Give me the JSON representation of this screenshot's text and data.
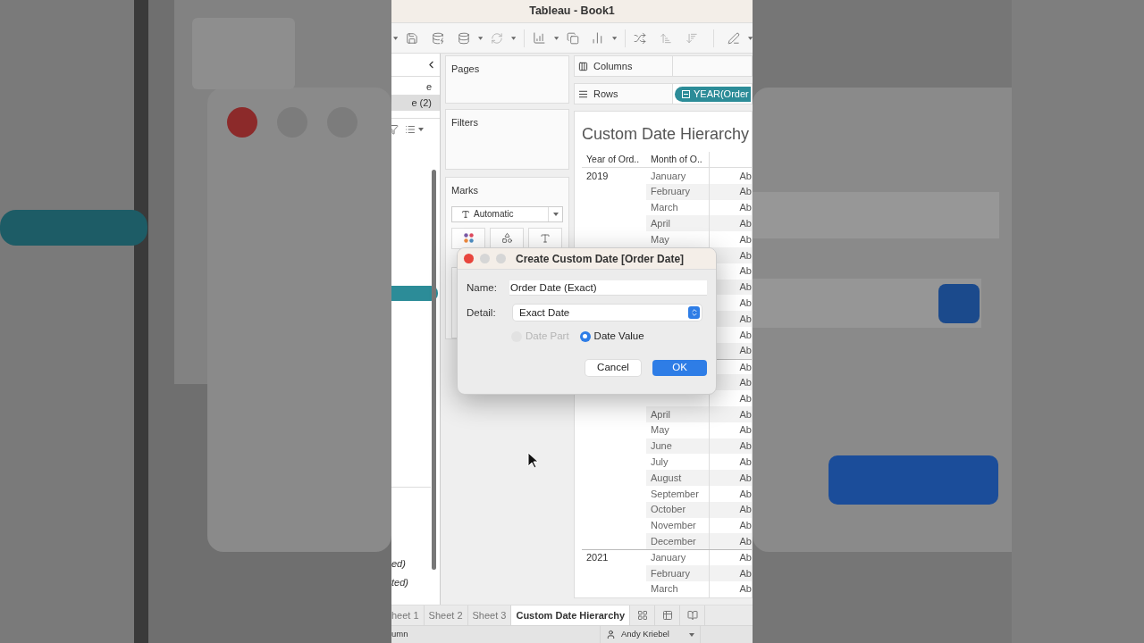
{
  "window": {
    "title": "Tableau - Book1"
  },
  "data_pane": {
    "items": [
      {
        "label": "e",
        "selected": false
      },
      {
        "label": "e (2)",
        "selected": true
      }
    ],
    "bottom_items": [
      "ed)",
      "ted)"
    ]
  },
  "cards": {
    "pages": "Pages",
    "filters": "Filters",
    "marks": "Marks",
    "mark_type": "Automatic"
  },
  "shelves": {
    "columns": "Columns",
    "rows": "Rows",
    "rows_pill": "YEAR(Order"
  },
  "view": {
    "title": "Custom Date Hierarchy",
    "columns": [
      "Year of Ord..",
      "Month of O.."
    ],
    "rows": [
      {
        "year": "2019",
        "month": "January",
        "column_3": "Ab"
      },
      {
        "month": "February",
        "column_3": "Ab"
      },
      {
        "month": "March",
        "column_3": "Ab"
      },
      {
        "month": "April",
        "column_3": "Ab"
      },
      {
        "month": "May",
        "column_3": "Ab"
      },
      {
        "column_3": "Ab"
      },
      {
        "column_3": "Ab"
      },
      {
        "column_3": "Ab"
      },
      {
        "column_3": "Ab"
      },
      {
        "column_3": "Ab"
      },
      {
        "column_3": "Ab"
      },
      {
        "column_3": "Ab"
      },
      {
        "group_start": true,
        "column_3": "Ab"
      },
      {
        "column_3": "Ab"
      },
      {
        "column_3": "Ab"
      },
      {
        "month": "April",
        "column_3": "Ab"
      },
      {
        "month": "May",
        "column_3": "Ab"
      },
      {
        "month": "June",
        "column_3": "Ab"
      },
      {
        "month": "July",
        "column_3": "Ab"
      },
      {
        "month": "August",
        "column_3": "Ab"
      },
      {
        "month": "September",
        "column_3": "Ab"
      },
      {
        "month": "October",
        "column_3": "Ab"
      },
      {
        "month": "November",
        "column_3": "Ab"
      },
      {
        "month": "December",
        "column_3": "Ab"
      },
      {
        "year": "2021",
        "month": "January",
        "column_3": "Ab"
      },
      {
        "month": "February",
        "column_3": "Ab"
      },
      {
        "month": "March",
        "column_3": "Ab"
      }
    ]
  },
  "dialog": {
    "title": "Create Custom Date [Order Date]",
    "name_label": "Name:",
    "name_value": "Order Date (Exact)",
    "detail_label": "Detail:",
    "detail_value": "Exact Date",
    "options": [
      {
        "label": "Date Part",
        "selected": false,
        "disabled": true
      },
      {
        "label": "Date Value",
        "selected": true,
        "disabled": false
      }
    ],
    "buttons": [
      {
        "label": "Cancel",
        "kind": "secondary"
      },
      {
        "label": "OK",
        "kind": "primary"
      }
    ]
  },
  "sheet_tabs": [
    {
      "label": "heet 1",
      "selected": false
    },
    {
      "label": "Sheet 2",
      "selected": false
    },
    {
      "label": "Sheet 3",
      "selected": false
    },
    {
      "label": "Custom Date Hierarchy",
      "selected": true
    }
  ],
  "status_bar": {
    "left": "umn",
    "user": "Andy Kriebel"
  }
}
